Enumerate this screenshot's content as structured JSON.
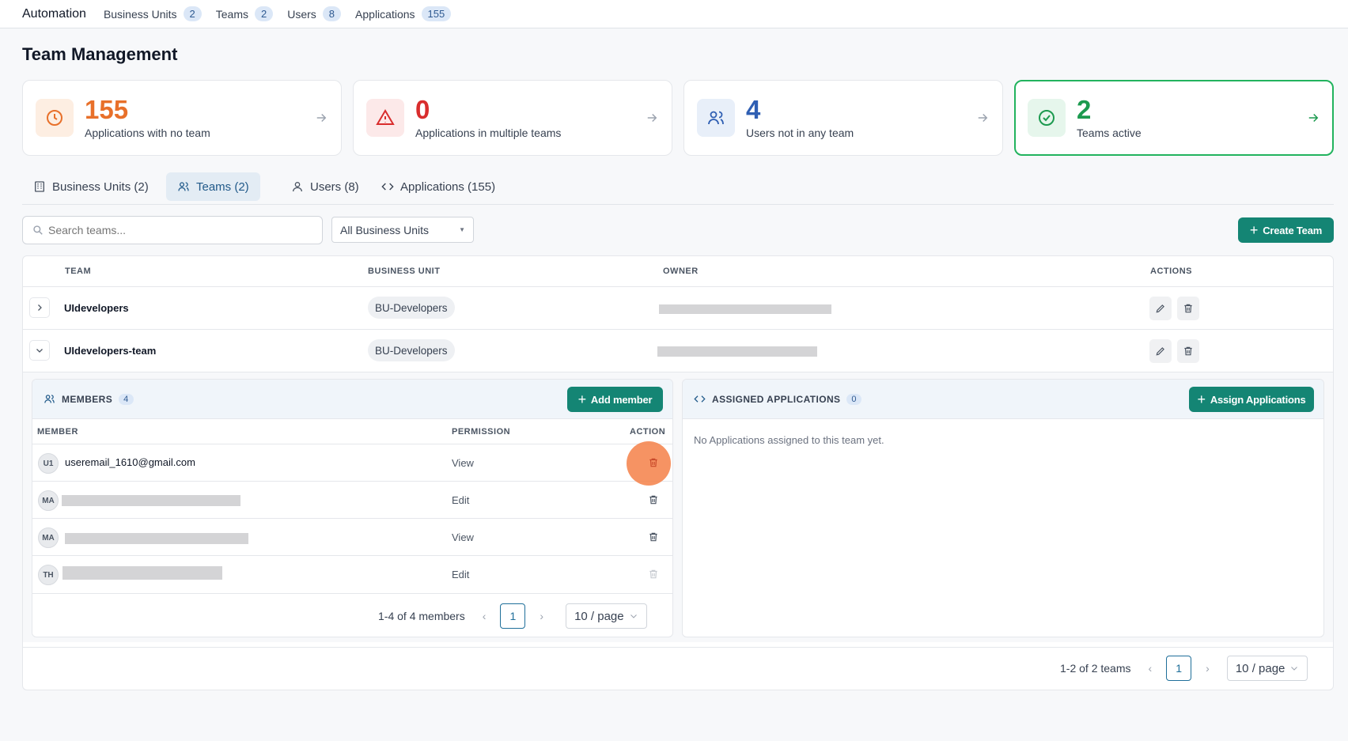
{
  "topnav": {
    "brand": "Automation",
    "items": [
      {
        "label": "Business Units",
        "count": "2"
      },
      {
        "label": "Teams",
        "count": "2"
      },
      {
        "label": "Users",
        "count": "8"
      },
      {
        "label": "Applications",
        "count": "155"
      }
    ]
  },
  "page_title": "Team Management",
  "cards": [
    {
      "value": "155",
      "label": "Applications with no team",
      "color": "#e8702a",
      "icon": "clock-icon"
    },
    {
      "value": "0",
      "label": "Applications in multiple teams",
      "color": "#d92d2d",
      "icon": "warning-icon"
    },
    {
      "value": "4",
      "label": "Users not in any team",
      "color": "#2f5fb3",
      "icon": "users-icon"
    },
    {
      "value": "2",
      "label": "Teams active",
      "color": "#1c9a4f",
      "icon": "check-circle-icon"
    }
  ],
  "tabs": [
    {
      "label": "Business Units (2)",
      "icon": "building-icon"
    },
    {
      "label": "Teams (2)",
      "icon": "users-icon",
      "selected": true
    },
    {
      "label": "Users (8)",
      "icon": "user-icon"
    },
    {
      "label": "Applications (155)",
      "icon": "code-icon"
    }
  ],
  "search": {
    "placeholder": "Search teams..."
  },
  "bu_filter": {
    "value": "All Business Units"
  },
  "create_team": "Create Team",
  "table": {
    "headers": [
      "TEAM",
      "BUSINESS UNIT",
      "OWNER",
      "ACTIONS"
    ],
    "rows": [
      {
        "team": "UIdevelopers",
        "bu": "BU-Developers",
        "expanded": false
      },
      {
        "team": "UIdevelopers-team",
        "bu": "BU-Developers",
        "expanded": true
      }
    ]
  },
  "members": {
    "title": "MEMBERS",
    "count": "4",
    "add_button": "Add member",
    "headers": [
      "MEMBER",
      "PERMISSION",
      "ACTION"
    ],
    "rows": [
      {
        "initials": "U1",
        "email": "useremail_1610@gmail.com",
        "permission": "View"
      },
      {
        "initials": "MA",
        "email": "",
        "permission": "Edit"
      },
      {
        "initials": "MA",
        "email": "",
        "permission": "View"
      },
      {
        "initials": "TH",
        "email": "",
        "permission": "Edit"
      }
    ],
    "pager_text": "1-4 of 4 members",
    "page": "1",
    "page_size": "10 / page"
  },
  "assigned": {
    "title": "ASSIGNED APPLICATIONS",
    "count": "0",
    "button": "Assign Applications",
    "empty_text": "No Applications assigned to this team yet."
  },
  "footer_pager": {
    "text": "1-2 of 2 teams",
    "page": "1",
    "page_size": "10 / page"
  }
}
